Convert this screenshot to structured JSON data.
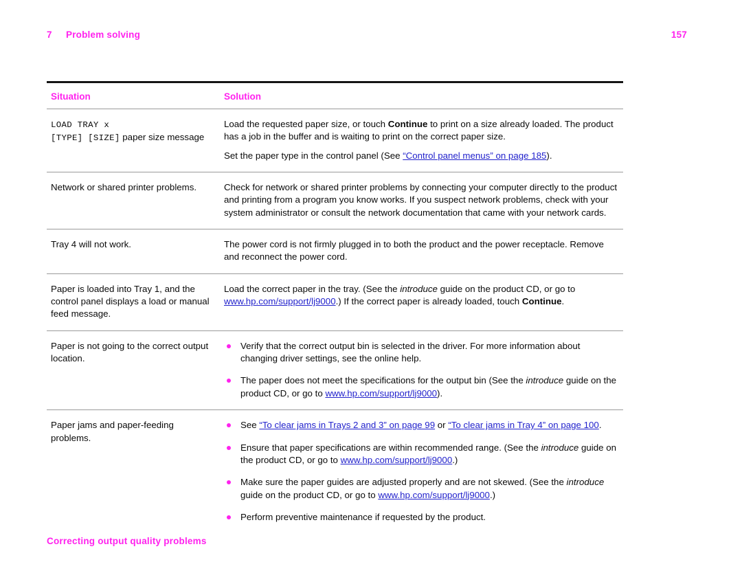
{
  "header": {
    "chapter_number": "7",
    "chapter_title": "Problem solving",
    "page_number": "157"
  },
  "footer": {
    "section_title": "Correcting output quality problems"
  },
  "table": {
    "columns": [
      "Situation",
      "Solution"
    ],
    "rows": [
      {
        "situation": {
          "mono_line_1": "LOAD TRAY x",
          "mono_line_2": "[TYPE] [SIZE]",
          "plain_tail": " paper size message"
        },
        "solution": {
          "para_1_before_bold": "Load the requested paper size, or touch ",
          "para_1_bold": "Continue",
          "para_1_after_bold": " to print on a size already loaded. The product has a job in the buffer and is waiting to print on the correct paper size.",
          "para_2_before_link": "Set the paper type in the control panel (See ",
          "para_2_link": "“Control panel menus” on page 185",
          "para_2_after_link": ")."
        }
      },
      {
        "situation": {
          "text": "Network or shared printer problems."
        },
        "solution": {
          "text": "Check for network or shared printer problems by connecting your computer directly to the product and printing from a program you know works. If you suspect network problems, check with your system administrator or consult the network documentation that came with your network cards."
        }
      },
      {
        "situation": {
          "text": "Tray 4 will not work."
        },
        "solution": {
          "text": "The power cord is not firmly plugged in to both the product and the power receptacle. Remove and reconnect the power cord."
        }
      },
      {
        "situation": {
          "text": "Paper is loaded into Tray 1, and the control panel displays a load or manual feed message."
        },
        "solution": {
          "seg_1": "Load the correct paper in the tray. (See the ",
          "seg_2_italic": "introduce",
          "seg_3": " guide on the product CD, or go to ",
          "seg_4_link": "www.hp.com/support/lj9000",
          "seg_5": ".) If the correct paper is already loaded, touch ",
          "seg_6_bold": "Continue",
          "seg_7": "."
        }
      },
      {
        "situation": {
          "text": "Paper is not going to the correct output location."
        },
        "solution": {
          "bullets": [
            {
              "seg_1": "Verify that the correct output bin is selected in the driver. For more information about changing driver settings, see the online help."
            },
            {
              "seg_1": "The paper does not meet the specifications for the output bin (See the ",
              "seg_2_italic": "introduce",
              "seg_3": " guide on the product CD, or go to ",
              "seg_4_link": "www.hp.com/support/lj9000",
              "seg_5": ")."
            }
          ]
        }
      },
      {
        "situation": {
          "text": "Paper jams and paper-feeding problems."
        },
        "solution": {
          "bullets": [
            {
              "seg_1": "See ",
              "link_1": "“To clear jams in Trays 2 and 3” on page 99",
              "seg_2": " or ",
              "link_2": "“To clear jams in Tray 4” on page 100",
              "seg_3": "."
            },
            {
              "seg_1": "Ensure that paper specifications are within recommended range. (See the ",
              "seg_2_italic": "introduce",
              "seg_3": " guide on the product CD, or go to ",
              "seg_4_link": "www.hp.com/support/lj9000",
              "seg_5": ".)"
            },
            {
              "seg_1": "Make sure the paper guides are adjusted properly and are not skewed. (See the ",
              "seg_2_italic": "introduce",
              "seg_3": " guide on the product CD, or go to ",
              "seg_4_link": "www.hp.com/support/lj9000",
              "seg_5": ".)"
            },
            {
              "seg_1": "Perform preventive maintenance if requested by the product."
            }
          ]
        }
      }
    ]
  },
  "colors": {
    "accent_magenta": "#FF22EE",
    "link_blue": "#2222CC",
    "rule_black": "#141414",
    "rule_gray": "#9A9A9A"
  }
}
